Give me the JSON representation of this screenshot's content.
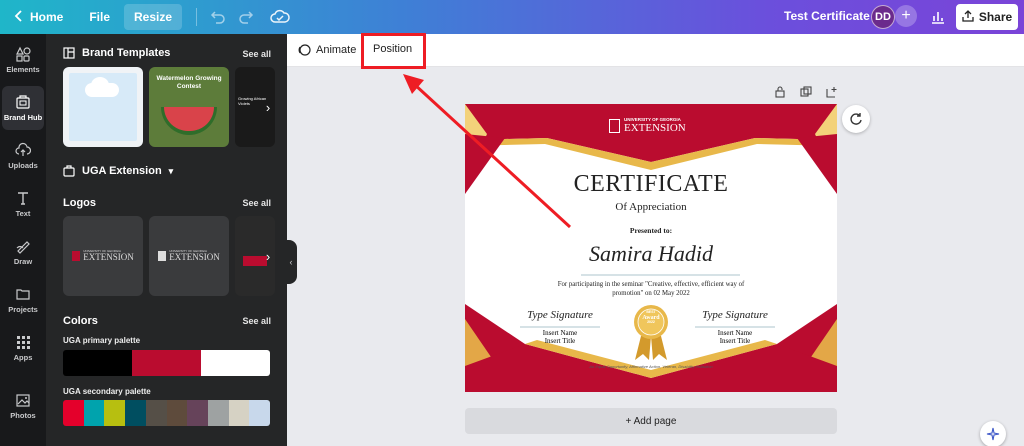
{
  "topbar": {
    "home": "Home",
    "file": "File",
    "resize": "Resize",
    "doc_title": "Test Certificate",
    "avatar_initials": "DD",
    "share": "Share"
  },
  "rail": {
    "items": [
      {
        "label": "Elements",
        "icon": "elements-icon"
      },
      {
        "label": "Brand Hub",
        "icon": "brand-hub-icon",
        "active": true
      },
      {
        "label": "Uploads",
        "icon": "upload-icon"
      },
      {
        "label": "Text",
        "icon": "text-icon"
      },
      {
        "label": "Draw",
        "icon": "draw-icon"
      },
      {
        "label": "Projects",
        "icon": "folder-icon"
      },
      {
        "label": "Apps",
        "icon": "apps-icon"
      },
      {
        "label": "Photos",
        "icon": "photos-icon"
      }
    ]
  },
  "panel": {
    "brand_templates": "Brand Templates",
    "see_all": "See all",
    "template_2_text": "Watermelon Growing Contest",
    "template_3_text": "Growing African Violets",
    "brand_kit": "UGA Extension",
    "logos": "Logos",
    "logo_university": "UNIVERSITY OF GEORGIA",
    "logo_extension": "EXTENSION",
    "colors": "Colors",
    "primary_palette": "UGA primary palette",
    "secondary_palette": "UGA secondary palette",
    "primary_colors": [
      "#000000",
      "#ba0c2f",
      "#ffffff"
    ],
    "secondary_colors": [
      "#e4002b",
      "#00a3ad",
      "#b7bf10",
      "#004e60",
      "#554f47",
      "#5e4b3c",
      "#66435a",
      "#9ea2a2",
      "#d6d2c4",
      "#c8d8eb"
    ]
  },
  "editor": {
    "animate": "Animate",
    "position": "Position"
  },
  "certificate": {
    "university": "UNIVERSITY OF GEORGIA",
    "extension": "EXTENSION",
    "title": "CERTIFICATE",
    "subtitle": "Of Appreciation",
    "presented_to": "Presented to:",
    "recipient": "Samira Hadid",
    "description_line1": "For participating in the seminar \"Creative, effective, efficient way of",
    "description_line2": "promotion\" on 02 May 2022",
    "signature_left": "Type Signature",
    "signature_right": "Type Signature",
    "name_left": "Insert Name",
    "title_left": "Insert Title",
    "name_right": "Insert Name",
    "title_right": "Insert Title",
    "badge_line1": "BEST",
    "badge_line2": "Award",
    "badge_line3": "2022",
    "footer": "An Equal Opportunity, Affirmative Action, Veteran, Disability Institution"
  },
  "canvas": {
    "add_page": "+ Add page"
  },
  "colors": {
    "accent_red": "#ba0c2f",
    "gold": "#e8b84a",
    "annotation_red": "#ee1d24"
  }
}
